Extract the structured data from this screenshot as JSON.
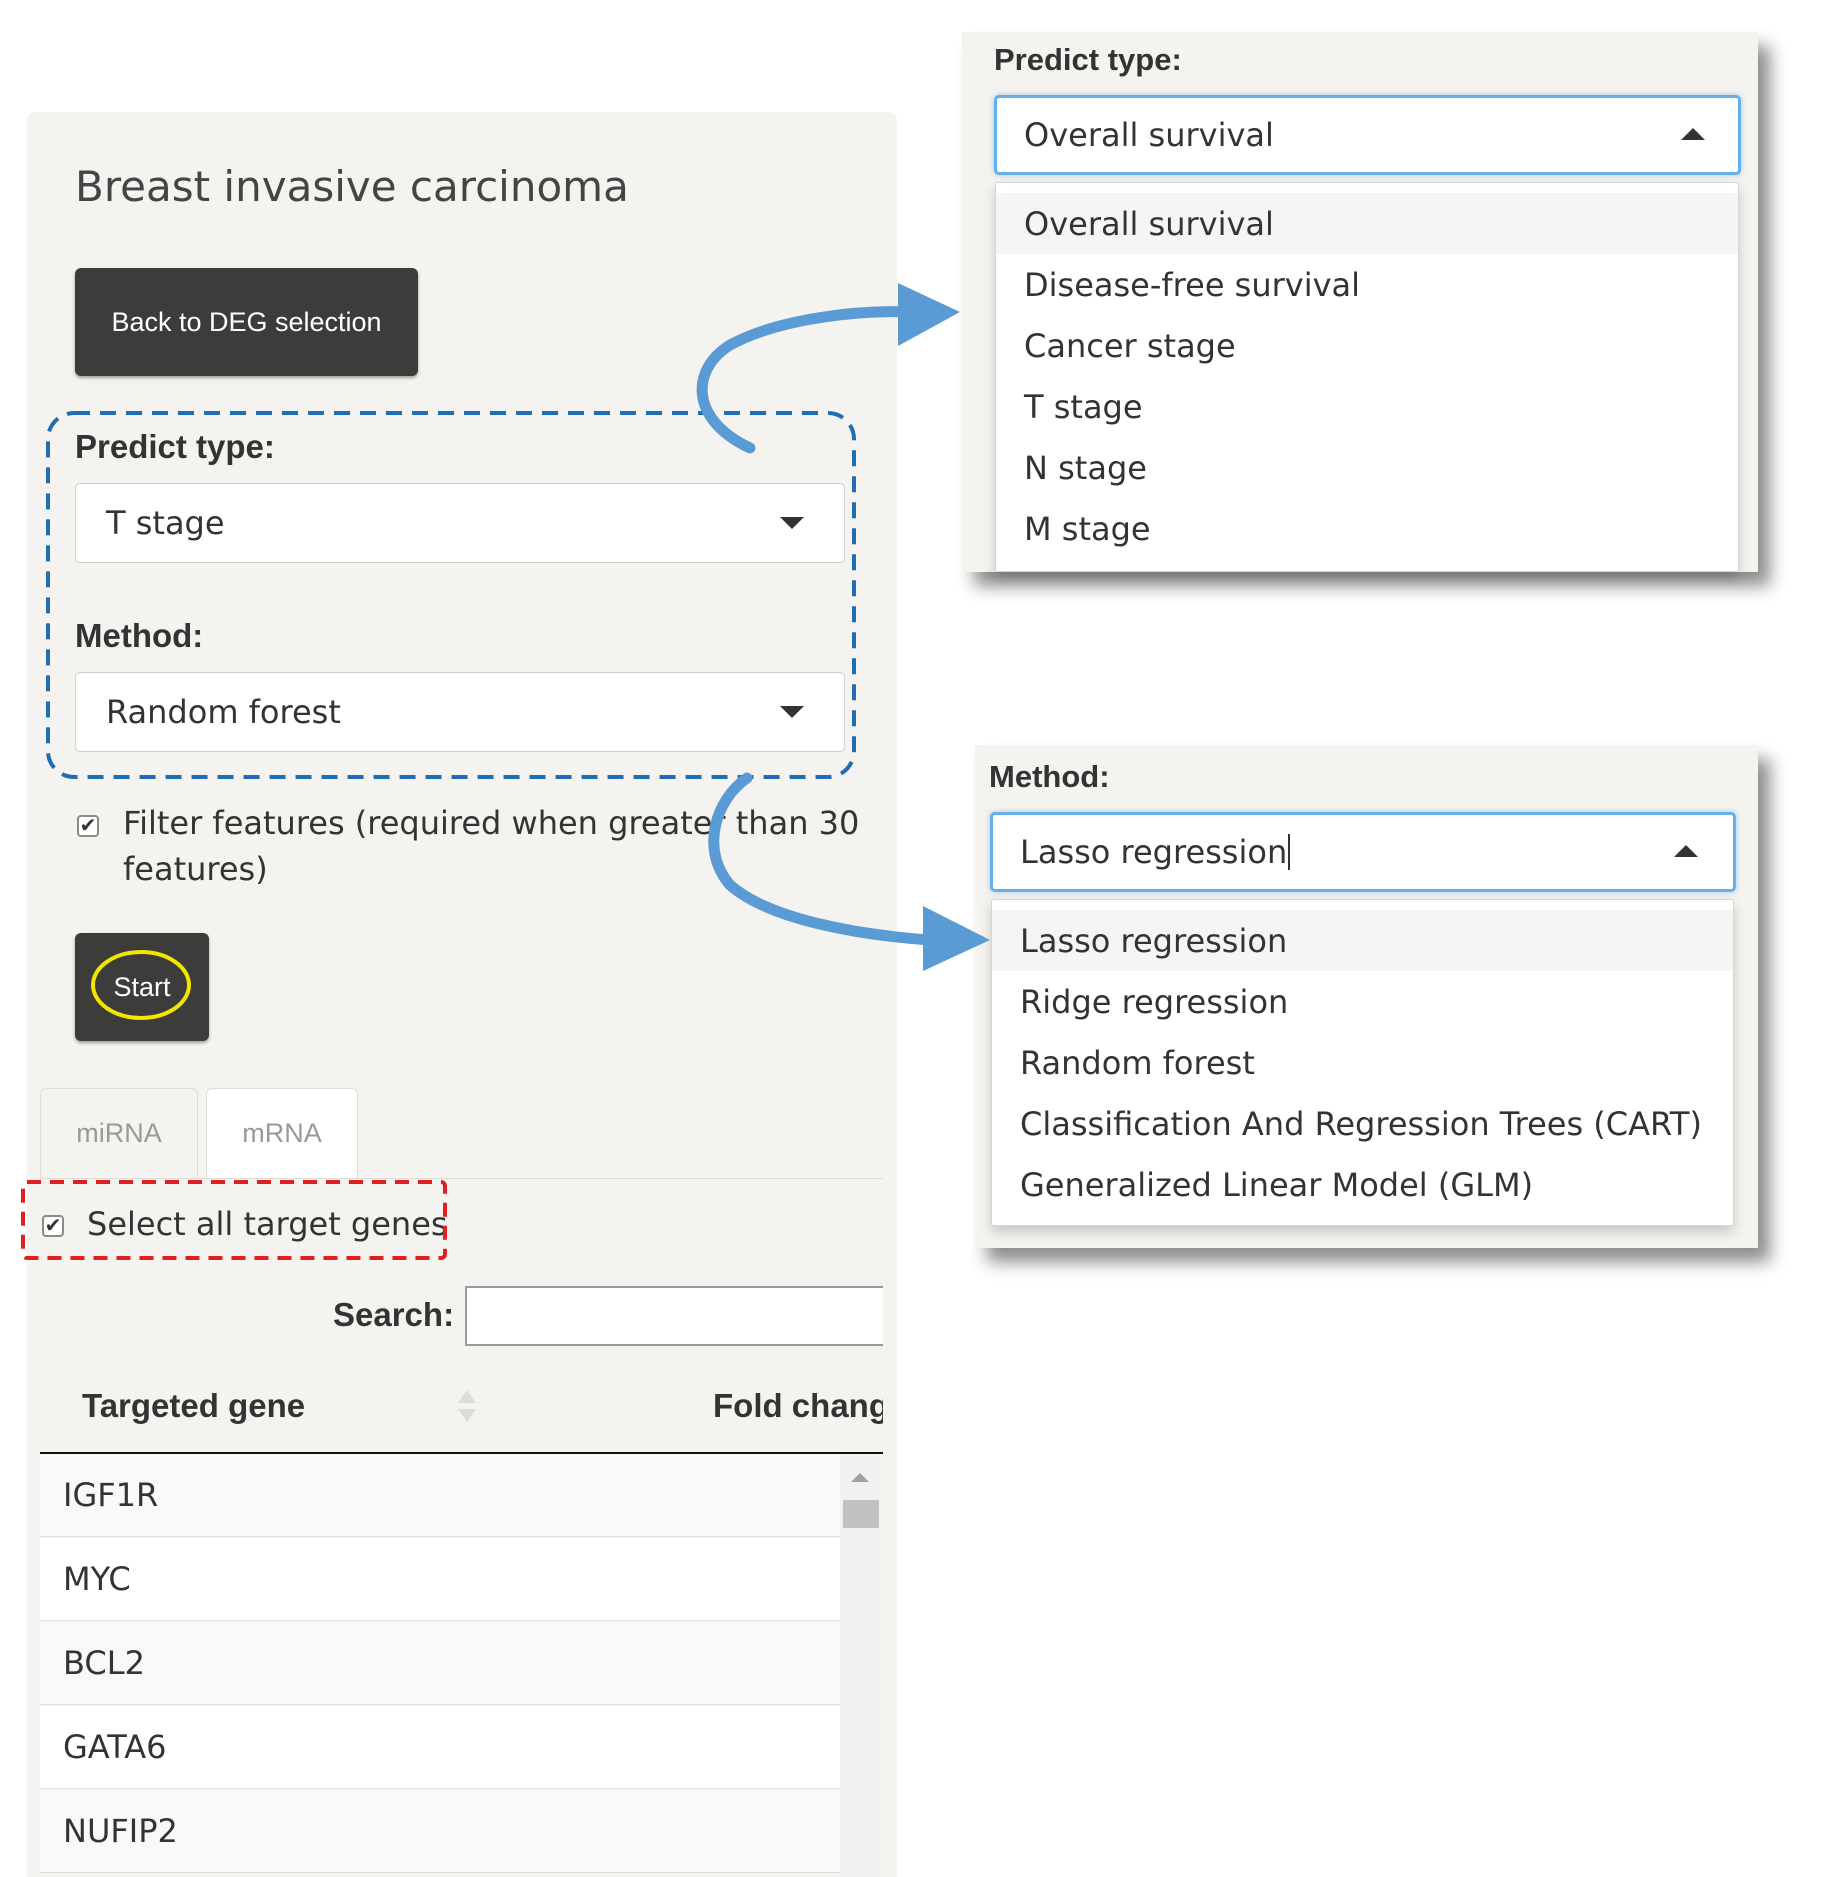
{
  "main": {
    "title": "Breast invasive carcinoma",
    "back_button": "Back to DEG selection",
    "predict_type": {
      "label": "Predict type:",
      "value": "T stage"
    },
    "method": {
      "label": "Method:",
      "value": "Random forest"
    },
    "filter_checkbox": {
      "checked": true,
      "label_line1": "Filter features (required when greater than 30",
      "label_line2": "features)"
    },
    "start_button": "Start",
    "tabs": [
      {
        "label": "miRNA"
      },
      {
        "label": "mRNA",
        "active": true
      }
    ],
    "select_all": {
      "checked": true,
      "label": "Select all target genes"
    },
    "search": {
      "label": "Search:",
      "value": "",
      "placeholder": ""
    },
    "table": {
      "columns": [
        "Targeted gene",
        "Fold chang"
      ],
      "rows": [
        "IGF1R",
        "MYC",
        "BCL2",
        "GATA6",
        "NUFIP2"
      ]
    }
  },
  "predict_popup": {
    "label": "Predict type:",
    "value": "Overall survival",
    "options": [
      "Overall survival",
      "Disease-free survival",
      "Cancer stage",
      "T stage",
      "N stage",
      "M stage"
    ]
  },
  "method_popup": {
    "label": "Method:",
    "value": "Lasso regression",
    "options": [
      "Lasso regression",
      "Ridge regression",
      "Random forest",
      "Classification And Regression Trees (CART)",
      "Generalized Linear Model (GLM)"
    ]
  },
  "annotation_colors": {
    "blue_dashed": "#1f6db5",
    "red_dashed": "#e02020",
    "yellow_circle": "#f2e600",
    "arrow": "#5b9bd5"
  }
}
